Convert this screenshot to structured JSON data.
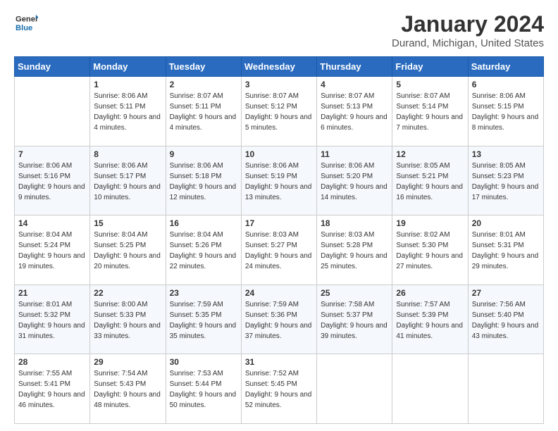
{
  "logo": {
    "line1": "General",
    "line2": "Blue"
  },
  "title": "January 2024",
  "subtitle": "Durand, Michigan, United States",
  "weekdays": [
    "Sunday",
    "Monday",
    "Tuesday",
    "Wednesday",
    "Thursday",
    "Friday",
    "Saturday"
  ],
  "weeks": [
    [
      {
        "day": "",
        "sunrise": "",
        "sunset": "",
        "daylight": ""
      },
      {
        "day": "1",
        "sunrise": "Sunrise: 8:06 AM",
        "sunset": "Sunset: 5:11 PM",
        "daylight": "Daylight: 9 hours and 4 minutes."
      },
      {
        "day": "2",
        "sunrise": "Sunrise: 8:07 AM",
        "sunset": "Sunset: 5:11 PM",
        "daylight": "Daylight: 9 hours and 4 minutes."
      },
      {
        "day": "3",
        "sunrise": "Sunrise: 8:07 AM",
        "sunset": "Sunset: 5:12 PM",
        "daylight": "Daylight: 9 hours and 5 minutes."
      },
      {
        "day": "4",
        "sunrise": "Sunrise: 8:07 AM",
        "sunset": "Sunset: 5:13 PM",
        "daylight": "Daylight: 9 hours and 6 minutes."
      },
      {
        "day": "5",
        "sunrise": "Sunrise: 8:07 AM",
        "sunset": "Sunset: 5:14 PM",
        "daylight": "Daylight: 9 hours and 7 minutes."
      },
      {
        "day": "6",
        "sunrise": "Sunrise: 8:06 AM",
        "sunset": "Sunset: 5:15 PM",
        "daylight": "Daylight: 9 hours and 8 minutes."
      }
    ],
    [
      {
        "day": "7",
        "sunrise": "Sunrise: 8:06 AM",
        "sunset": "Sunset: 5:16 PM",
        "daylight": "Daylight: 9 hours and 9 minutes."
      },
      {
        "day": "8",
        "sunrise": "Sunrise: 8:06 AM",
        "sunset": "Sunset: 5:17 PM",
        "daylight": "Daylight: 9 hours and 10 minutes."
      },
      {
        "day": "9",
        "sunrise": "Sunrise: 8:06 AM",
        "sunset": "Sunset: 5:18 PM",
        "daylight": "Daylight: 9 hours and 12 minutes."
      },
      {
        "day": "10",
        "sunrise": "Sunrise: 8:06 AM",
        "sunset": "Sunset: 5:19 PM",
        "daylight": "Daylight: 9 hours and 13 minutes."
      },
      {
        "day": "11",
        "sunrise": "Sunrise: 8:06 AM",
        "sunset": "Sunset: 5:20 PM",
        "daylight": "Daylight: 9 hours and 14 minutes."
      },
      {
        "day": "12",
        "sunrise": "Sunrise: 8:05 AM",
        "sunset": "Sunset: 5:21 PM",
        "daylight": "Daylight: 9 hours and 16 minutes."
      },
      {
        "day": "13",
        "sunrise": "Sunrise: 8:05 AM",
        "sunset": "Sunset: 5:23 PM",
        "daylight": "Daylight: 9 hours and 17 minutes."
      }
    ],
    [
      {
        "day": "14",
        "sunrise": "Sunrise: 8:04 AM",
        "sunset": "Sunset: 5:24 PM",
        "daylight": "Daylight: 9 hours and 19 minutes."
      },
      {
        "day": "15",
        "sunrise": "Sunrise: 8:04 AM",
        "sunset": "Sunset: 5:25 PM",
        "daylight": "Daylight: 9 hours and 20 minutes."
      },
      {
        "day": "16",
        "sunrise": "Sunrise: 8:04 AM",
        "sunset": "Sunset: 5:26 PM",
        "daylight": "Daylight: 9 hours and 22 minutes."
      },
      {
        "day": "17",
        "sunrise": "Sunrise: 8:03 AM",
        "sunset": "Sunset: 5:27 PM",
        "daylight": "Daylight: 9 hours and 24 minutes."
      },
      {
        "day": "18",
        "sunrise": "Sunrise: 8:03 AM",
        "sunset": "Sunset: 5:28 PM",
        "daylight": "Daylight: 9 hours and 25 minutes."
      },
      {
        "day": "19",
        "sunrise": "Sunrise: 8:02 AM",
        "sunset": "Sunset: 5:30 PM",
        "daylight": "Daylight: 9 hours and 27 minutes."
      },
      {
        "day": "20",
        "sunrise": "Sunrise: 8:01 AM",
        "sunset": "Sunset: 5:31 PM",
        "daylight": "Daylight: 9 hours and 29 minutes."
      }
    ],
    [
      {
        "day": "21",
        "sunrise": "Sunrise: 8:01 AM",
        "sunset": "Sunset: 5:32 PM",
        "daylight": "Daylight: 9 hours and 31 minutes."
      },
      {
        "day": "22",
        "sunrise": "Sunrise: 8:00 AM",
        "sunset": "Sunset: 5:33 PM",
        "daylight": "Daylight: 9 hours and 33 minutes."
      },
      {
        "day": "23",
        "sunrise": "Sunrise: 7:59 AM",
        "sunset": "Sunset: 5:35 PM",
        "daylight": "Daylight: 9 hours and 35 minutes."
      },
      {
        "day": "24",
        "sunrise": "Sunrise: 7:59 AM",
        "sunset": "Sunset: 5:36 PM",
        "daylight": "Daylight: 9 hours and 37 minutes."
      },
      {
        "day": "25",
        "sunrise": "Sunrise: 7:58 AM",
        "sunset": "Sunset: 5:37 PM",
        "daylight": "Daylight: 9 hours and 39 minutes."
      },
      {
        "day": "26",
        "sunrise": "Sunrise: 7:57 AM",
        "sunset": "Sunset: 5:39 PM",
        "daylight": "Daylight: 9 hours and 41 minutes."
      },
      {
        "day": "27",
        "sunrise": "Sunrise: 7:56 AM",
        "sunset": "Sunset: 5:40 PM",
        "daylight": "Daylight: 9 hours and 43 minutes."
      }
    ],
    [
      {
        "day": "28",
        "sunrise": "Sunrise: 7:55 AM",
        "sunset": "Sunset: 5:41 PM",
        "daylight": "Daylight: 9 hours and 46 minutes."
      },
      {
        "day": "29",
        "sunrise": "Sunrise: 7:54 AM",
        "sunset": "Sunset: 5:43 PM",
        "daylight": "Daylight: 9 hours and 48 minutes."
      },
      {
        "day": "30",
        "sunrise": "Sunrise: 7:53 AM",
        "sunset": "Sunset: 5:44 PM",
        "daylight": "Daylight: 9 hours and 50 minutes."
      },
      {
        "day": "31",
        "sunrise": "Sunrise: 7:52 AM",
        "sunset": "Sunset: 5:45 PM",
        "daylight": "Daylight: 9 hours and 52 minutes."
      },
      {
        "day": "",
        "sunrise": "",
        "sunset": "",
        "daylight": ""
      },
      {
        "day": "",
        "sunrise": "",
        "sunset": "",
        "daylight": ""
      },
      {
        "day": "",
        "sunrise": "",
        "sunset": "",
        "daylight": ""
      }
    ]
  ]
}
